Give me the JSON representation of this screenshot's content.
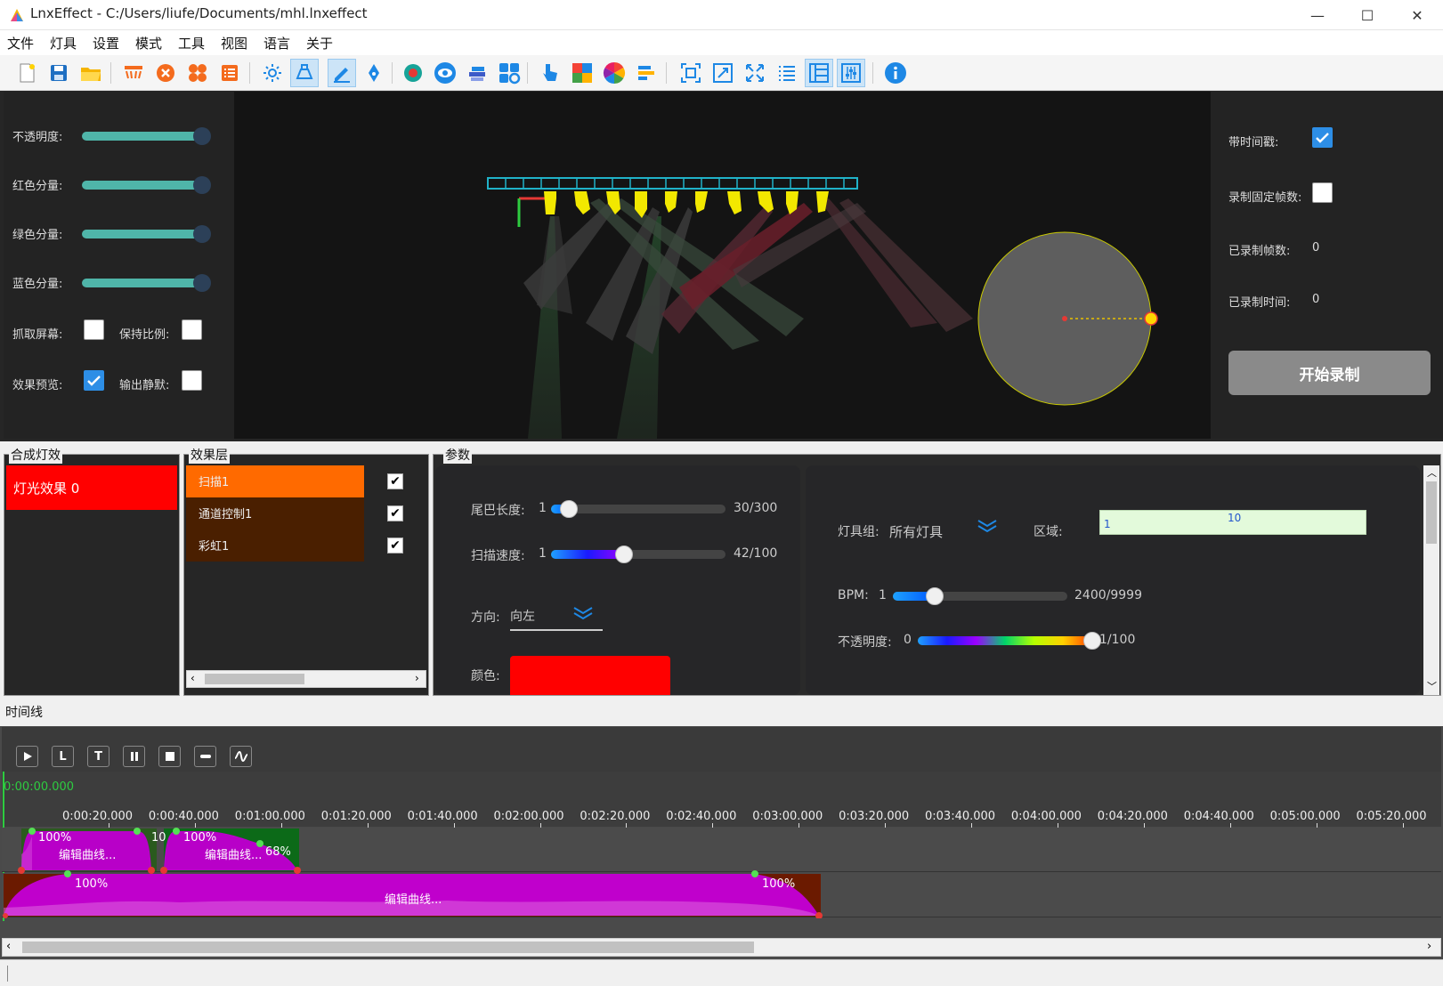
{
  "window": {
    "title": "LnxEffect - C:/Users/liufe/Documents/mhl.lnxeffect",
    "min": "—",
    "max": "☐",
    "close": "✕"
  },
  "menu": [
    "文件",
    "灯具",
    "设置",
    "模式",
    "工具",
    "视图",
    "语言",
    "关于"
  ],
  "toolbar_icons": [
    "new-file-icon",
    "save-icon",
    "open-folder-icon",
    "fixture-bar-icon",
    "close-circle-icon",
    "cluster-icon",
    "list-icon",
    "sun-icon",
    "spotlight-icon",
    "pen-icon",
    "pen-nib-icon",
    "record-dot-icon",
    "eye-icon",
    "layers-icon",
    "grid-gear-icon",
    "pointer-icon",
    "color-grid-icon",
    "color-wheel-icon",
    "align-left-icon",
    "fit-frame-icon",
    "expand-icon",
    "fullscreen-icon",
    "list-lines-icon",
    "panel-icon",
    "sliders-icon",
    "info-icon"
  ],
  "left_panel": {
    "opacity_label": "不透明度:",
    "red_label": "红色分量:",
    "green_label": "绿色分量:",
    "blue_label": "蓝色分量:",
    "capture_label": "抓取屏幕:",
    "keep_ratio_label": "保持比例:",
    "preview_label": "效果预览:",
    "mute_label": "输出静默:",
    "capture_checked": false,
    "keep_ratio_checked": false,
    "preview_checked": true,
    "mute_checked": false,
    "slider_levels": [
      1,
      1,
      1,
      1
    ]
  },
  "right_panel": {
    "timestamp_label": "带时间戳:",
    "fixed_frames_label": "录制固定帧数:",
    "recorded_frames_label": "已录制帧数:",
    "recorded_frames_value": "0",
    "recorded_time_label": "已录制时间:",
    "recorded_time_value": "0",
    "timestamp_checked": true,
    "fixed_frames_checked": false,
    "record_button": "开始录制"
  },
  "groups": {
    "composite_title": "合成灯效",
    "layers_title": "效果层",
    "params_title": "参数"
  },
  "composite_effects": [
    "灯光效果 0"
  ],
  "layers": [
    {
      "name": "扫描1",
      "checked": true,
      "color": "#ff6a00"
    },
    {
      "name": "通道控制1",
      "checked": true,
      "color": "#4a1f00"
    },
    {
      "name": "彩虹1",
      "checked": true,
      "color": "#4a1f00"
    }
  ],
  "params": {
    "tail_label": "尾巴长度:",
    "tail_min": "1",
    "tail_value": "30/300",
    "tail_fraction": 0.1,
    "speed_label": "扫描速度:",
    "speed_min": "1",
    "speed_value": "42/100",
    "speed_fraction": 0.42,
    "direction_label": "方向:",
    "direction_value": "向左",
    "color_label": "颜色:",
    "color_value": "#ff0000",
    "group_label": "灯具组:",
    "group_value": "所有灯具",
    "area_label": "区域:",
    "area_start": "1",
    "area_end": "10",
    "bpm_label": "BPM:",
    "bpm_min": "1",
    "bpm_value": "2400/9999",
    "bpm_fraction": 0.24,
    "opacity_label": "不透明度:",
    "opacity_min": "0",
    "opacity_value": "1/100",
    "opacity_fraction": 1
  },
  "timeline": {
    "label": "时间线",
    "time": "0:00:00.000",
    "buttons": [
      "play-icon",
      "loop-l-icon",
      "tempo-t-icon",
      "pause-icon",
      "stop-icon",
      "minus-icon",
      "wave-icon"
    ],
    "button_labels": [
      "",
      "L",
      "T",
      "",
      "",
      "",
      ""
    ],
    "ticks": [
      "0:00:20.000",
      "0:00:40.000",
      "0:01:00.000",
      "0:01:20.000",
      "0:01:40.000",
      "0:02:00.000",
      "0:02:20.000",
      "0:02:40.000",
      "0:03:00.000",
      "0:03:20.000",
      "0:03:40.000",
      "0:04:00.000",
      "0:04:20.000",
      "0:04:40.000",
      "0:05:00.000",
      "0:05:20.000"
    ],
    "track1": {
      "clip1_pct": "100%",
      "clip1_label": "编辑曲线...",
      "clip1_end": "10",
      "clip2_pct": "100%",
      "clip2_label": "编辑曲线...",
      "clip2_end": "68%"
    },
    "track2": {
      "start_pct": "100%",
      "label": "编辑曲线...",
      "end_pct": "100%"
    }
  }
}
